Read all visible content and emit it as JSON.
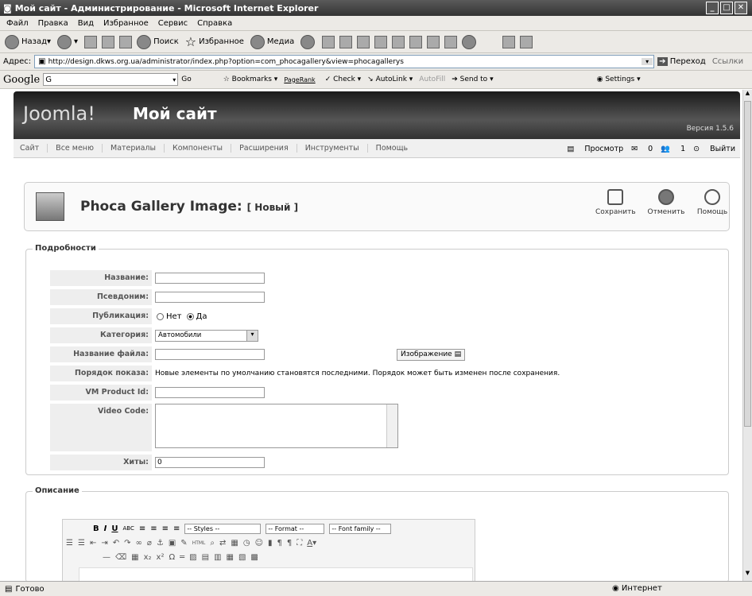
{
  "window": {
    "title": "Мой сайт - Администрирование - Microsoft Internet Explorer"
  },
  "menu": [
    "Файл",
    "Правка",
    "Вид",
    "Избранное",
    "Сервис",
    "Справка"
  ],
  "toolbar": {
    "back": "Назад",
    "search": "Поиск",
    "favorites": "Избранное",
    "media": "Медиа"
  },
  "address": {
    "label": "Адрес:",
    "url": "http://design.dkws.org.ua/administrator/index.php?option=com_phocagallery&view=phocagallerys",
    "go": "Переход",
    "links": "Ссылки"
  },
  "google": {
    "logo": "Google",
    "g": "G",
    "go": "Go",
    "bookmarks": "Bookmarks",
    "pagerank": "PageRank",
    "check": "Check",
    "autolink": "AutoLink",
    "autofill": "AutoFill",
    "sendto": "Send to",
    "settings": "Settings"
  },
  "joomla": {
    "logo": "Joomla!",
    "site": "Мой сайт",
    "version": "Версия 1.5.6"
  },
  "nav": [
    "Сайт",
    "Все меню",
    "Материалы",
    "Компоненты",
    "Расширения",
    "Инструменты",
    "Помощь"
  ],
  "nav_right": {
    "preview": "Просмотр",
    "count1": "0",
    "count2": "1",
    "logout": "Выйти"
  },
  "page": {
    "title": "Phoca Gallery Image:",
    "subtitle": "[ Новый ]"
  },
  "actions": {
    "save": "Сохранить",
    "cancel": "Отменить",
    "help": "Помощь"
  },
  "details": {
    "legend": "Подробности",
    "name": "Название:",
    "alias": "Псевдоним:",
    "published": "Публикация:",
    "no": "Нет",
    "yes": "Да",
    "category": "Категория:",
    "category_value": "Автомобили",
    "filename": "Название файла:",
    "image_button": "Изображение",
    "order": "Порядок показа:",
    "order_note": "Новые элементы по умолчанию становятся последними. Порядок может быть изменен после сохранения.",
    "vm": "VM Product Id:",
    "video": "Video Code:",
    "hits": "Хиты:",
    "hits_value": "0"
  },
  "description": {
    "legend": "Описание",
    "styles": "-- Styles --",
    "format": "-- Format --",
    "font": "-- Font family --"
  },
  "status": {
    "ready": "Готово",
    "zone": "Интернет"
  }
}
